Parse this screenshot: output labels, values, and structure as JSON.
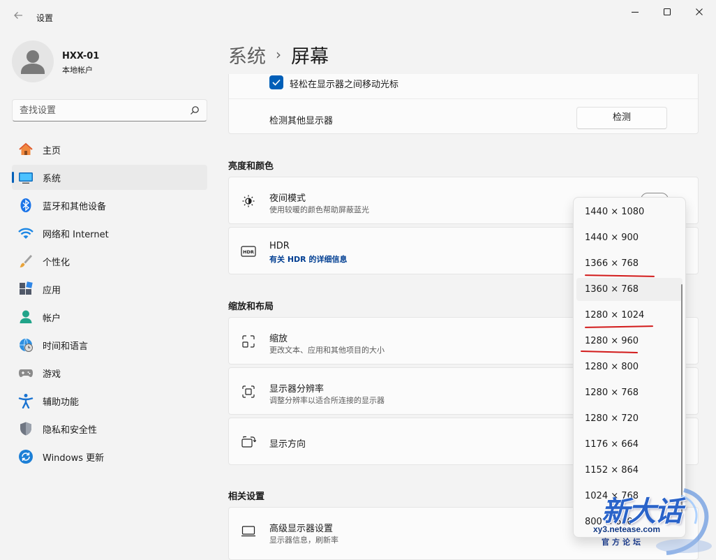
{
  "window": {
    "title": "设置",
    "controls": {
      "minimize": "minimize-icon",
      "maximize": "maximize-icon",
      "close": "close-icon"
    }
  },
  "user": {
    "name": "HXX-01",
    "account": "本地帐户"
  },
  "search": {
    "placeholder": "查找设置"
  },
  "sidebar": {
    "items": [
      {
        "label": "主页",
        "icon": "home-icon"
      },
      {
        "label": "系统",
        "icon": "system-icon",
        "active": true
      },
      {
        "label": "蓝牙和其他设备",
        "icon": "bluetooth-icon"
      },
      {
        "label": "网络和 Internet",
        "icon": "wifi-icon"
      },
      {
        "label": "个性化",
        "icon": "brush-icon"
      },
      {
        "label": "应用",
        "icon": "apps-icon"
      },
      {
        "label": "帐户",
        "icon": "account-icon"
      },
      {
        "label": "时间和语言",
        "icon": "globe-clock-icon"
      },
      {
        "label": "游戏",
        "icon": "gamepad-icon"
      },
      {
        "label": "辅助功能",
        "icon": "accessibility-icon"
      },
      {
        "label": "隐私和安全性",
        "icon": "shield-icon"
      },
      {
        "label": "Windows 更新",
        "icon": "update-icon"
      }
    ]
  },
  "breadcrumb": {
    "parent": "系统",
    "separator": "›",
    "current": "屏幕"
  },
  "multi_display": {
    "move_cursor_label": "轻松在显示器之间移动光标",
    "move_cursor_checked": true,
    "detect_label": "检测其他显示器",
    "detect_button": "检测"
  },
  "brightness_section": {
    "title": "亮度和颜色",
    "night_light": {
      "title": "夜间模式",
      "subtitle": "使用较暖的颜色帮助屏蔽蓝光"
    },
    "hdr": {
      "title": "HDR",
      "link": "有关 HDR 的详细信息"
    }
  },
  "scale_section": {
    "title": "缩放和布局",
    "scale": {
      "title": "缩放",
      "subtitle": "更改文本、应用和其他项目的大小"
    },
    "resolution": {
      "title": "显示器分辨率",
      "subtitle": "调整分辨率以适合所连接的显示器"
    },
    "orientation": {
      "title": "显示方向"
    }
  },
  "related_section": {
    "title": "相关设置",
    "advanced": {
      "title": "高级显示器设置",
      "subtitle": "显示器信息，刷新率"
    }
  },
  "resolution_dropdown": {
    "options": [
      "1440 × 1080",
      "1440 × 900",
      "1366 × 768",
      "1360 × 768",
      "1280 × 1024",
      "1280 × 960",
      "1280 × 800",
      "1280 × 768",
      "1280 × 720",
      "1176 × 664",
      "1152 × 864",
      "1024 × 768",
      "800 × 600"
    ],
    "hovered": "1360 × 768",
    "underlined": [
      "1366 × 768",
      "1280 × 1024",
      "1280 × 960"
    ]
  },
  "watermark": {
    "logo": "新大话",
    "url": "xy3.netease.com",
    "subtitle": "官方论坛"
  },
  "colors": {
    "accent": "#005fb8",
    "link": "#003e92",
    "annotation_red": "#d21a1a"
  }
}
